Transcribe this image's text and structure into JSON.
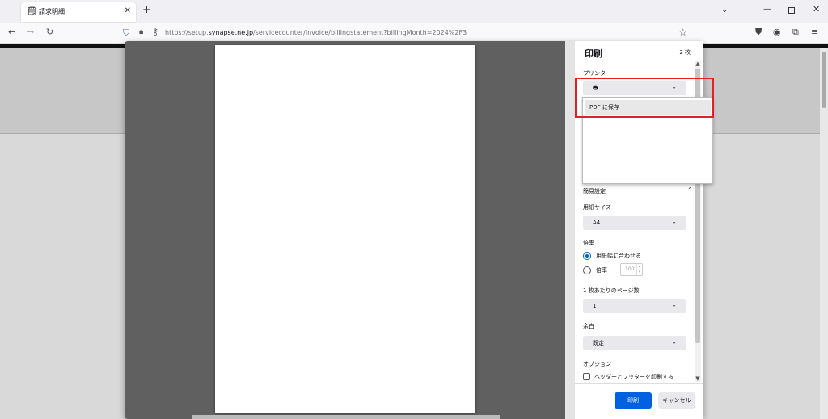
{
  "browser": {
    "tab": {
      "title": "請求明細",
      "favicon": "invoice-favicon-icon",
      "close": "✕"
    },
    "new_tab": "+",
    "window_controls": {
      "list_all_tabs": "⌄",
      "minimize": "—",
      "close": "✕"
    },
    "nav": {
      "back": "←",
      "forward": "→",
      "reload": "↻"
    },
    "url": {
      "prefix": "https://setup.",
      "domain": "synapse.ne.jp",
      "path": "/servicecounter/invoice/billingstatement?billingMonth=2024%2F3"
    },
    "toolbar_icons": [
      "pocket-icon",
      "account-icon",
      "extensions-icon",
      "menu-icon"
    ]
  },
  "print": {
    "title": "印刷",
    "sheet_count": "2 枚",
    "printer_label": "プリンター",
    "printer_dropdown": {
      "selected": "",
      "options": [
        "PDF に保存"
      ]
    },
    "simple_settings": "簡易設定",
    "paper_size_label": "用紙サイズ",
    "paper_size": "A4",
    "scale_label": "倍率",
    "scale_options": [
      "用紙幅に合わせる",
      "倍率"
    ],
    "scale_selected": "用紙幅に合わせる",
    "scale_value": "100",
    "pages_per_sheet_label": "1 枚あたりのページ数",
    "pages_per_sheet": "1",
    "margins_label": "余白",
    "margins": "既定",
    "options_label": "オプション",
    "header_footer_option": "ヘッダーとフッターを印刷する",
    "print_button": "印刷",
    "cancel_button": "キャンセル"
  },
  "colors": {
    "accent": "#0061e0",
    "highlight": "#e0202a"
  }
}
